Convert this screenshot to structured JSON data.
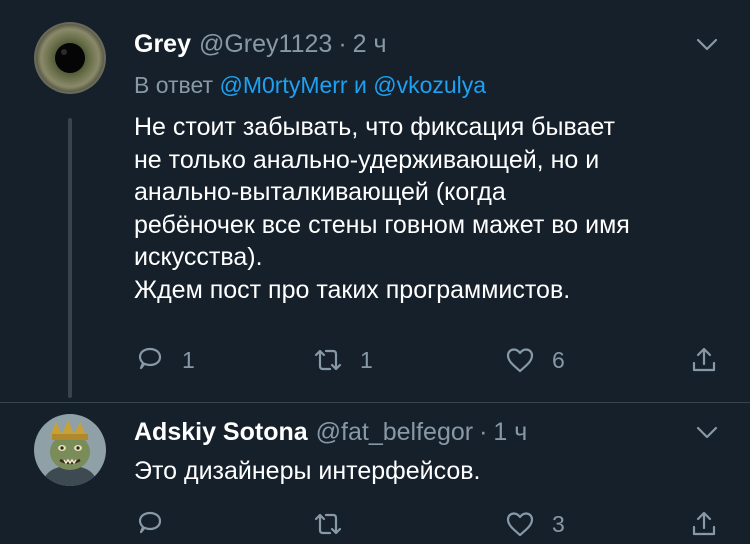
{
  "tweets": [
    {
      "author_name": "Grey",
      "handle": "@Grey1123",
      "time": "2 ч",
      "reply_prefix": "В ответ",
      "reply_mention1": "@M0rtyMerr",
      "reply_and": "и",
      "reply_mention2": "@vkozulya",
      "body_lines": [
        "Не стоит забывать, что фиксация бывает",
        "не только анально-удерживающей, но и",
        "анально-выталкивающей (когда",
        "ребёночек все стены говном мажет во имя",
        "искусства).",
        "Ждем пост про таких программистов."
      ],
      "reply_count": "1",
      "retweet_count": "1",
      "like_count": "6",
      "avatar_icon": "eye-iris-avatar"
    },
    {
      "author_name": "Adskiy Sotona",
      "handle": "@fat_belfegor",
      "time": "1 ч",
      "body_lines": [
        "Это дизайнеры интерфейсов."
      ],
      "retweet_count": "",
      "like_count": "3",
      "avatar_icon": "cartoon-character-avatar"
    }
  ],
  "separator": "·",
  "colors": {
    "background": "#15202b",
    "secondary_text": "#8899a6",
    "link": "#1da1f2",
    "divider": "#38444d"
  }
}
